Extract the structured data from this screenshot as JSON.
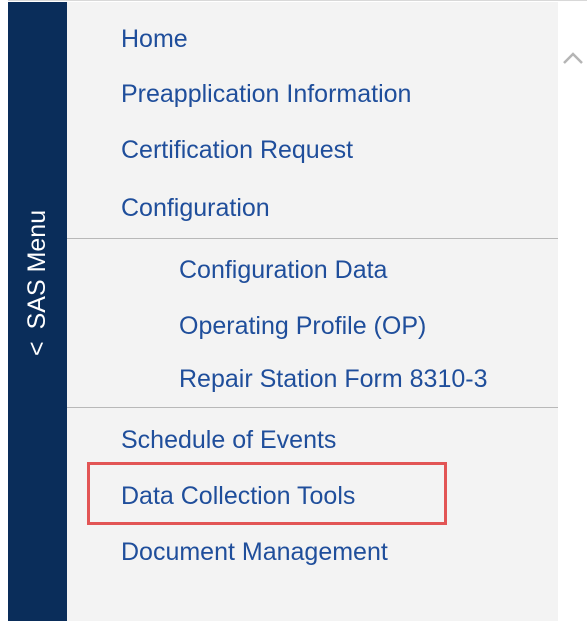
{
  "sas_menu": {
    "label": "SAS Menu",
    "caret": "<"
  },
  "menu": {
    "items": [
      {
        "label": "Home"
      },
      {
        "label": "Preapplication Information"
      },
      {
        "label": "Certification Request"
      },
      {
        "label": "Configuration"
      }
    ],
    "configuration_subitems": [
      {
        "label": "Configuration Data"
      },
      {
        "label": "Operating Profile (OP)"
      },
      {
        "label": "Repair Station Form 8310-3"
      }
    ],
    "lower_items": [
      {
        "label": "Schedule of Events"
      },
      {
        "label": "Data Collection Tools"
      },
      {
        "label": "Document Management"
      }
    ]
  },
  "colors": {
    "sidebar": "#0a2d5a",
    "link": "#1f4e9b",
    "highlight": "#e25555",
    "panel": "#f3f3f3"
  },
  "icons": {
    "scroll_up": "chevron-up-icon"
  }
}
